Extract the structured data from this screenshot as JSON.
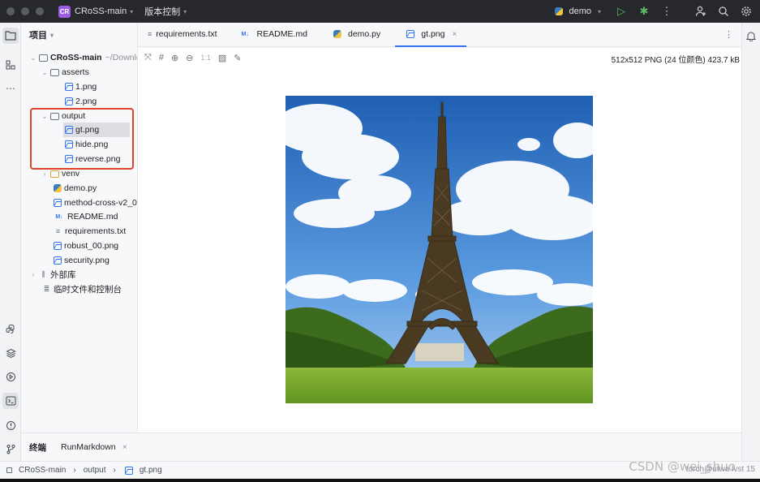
{
  "titlebar": {
    "project_badge": "CR",
    "project_name": "CRoSS-main",
    "vcs_label": "版本控制",
    "run_config": "demo",
    "icons": [
      "run-icon",
      "debug-icon",
      "more-icon",
      "add-user-icon",
      "search-icon",
      "settings-icon"
    ]
  },
  "project_panel": {
    "title": "项目",
    "root_name": "CRoSS-main",
    "root_path": "~/Downlo",
    "items": [
      {
        "label": "asserts",
        "type": "folder"
      },
      {
        "label": "1.png",
        "type": "image"
      },
      {
        "label": "2.png",
        "type": "image"
      },
      {
        "label": "output",
        "type": "folder"
      },
      {
        "label": "gt.png",
        "type": "image"
      },
      {
        "label": "hide.png",
        "type": "image"
      },
      {
        "label": "reverse.png",
        "type": "image"
      },
      {
        "label": "venv",
        "type": "folder"
      },
      {
        "label": "demo.py",
        "type": "python"
      },
      {
        "label": "method-cross-v2_0",
        "type": "image"
      },
      {
        "label": "README.md",
        "type": "markdown"
      },
      {
        "label": "requirements.txt",
        "type": "text"
      },
      {
        "label": "robust_00.png",
        "type": "image"
      },
      {
        "label": "security.png",
        "type": "image"
      },
      {
        "label": "外部库",
        "type": "library"
      },
      {
        "label": "临时文件和控制台",
        "type": "scratch"
      }
    ]
  },
  "tabs": [
    {
      "label": "requirements.txt",
      "icon": "text-file-icon"
    },
    {
      "label": "README.md",
      "icon": "markdown-icon",
      "prefix": "M↓"
    },
    {
      "label": "demo.py",
      "icon": "python-icon"
    },
    {
      "label": "gt.png",
      "icon": "image-icon",
      "active": true
    }
  ],
  "image_toolbar": {
    "zoom_label": "1:1",
    "info": "512x512 PNG (24 位颜色) 423.7 kB"
  },
  "bottom": {
    "title": "终端",
    "tab_label": "RunMarkdown"
  },
  "statusbar": {
    "crumbs": [
      "CRoSS-main",
      "output",
      "gt.png"
    ],
    "right": "torch@utwa lvst 15"
  },
  "watermark": "CSDN @wei_shuo",
  "colors": {
    "accent": "#3574f0",
    "highlight_box": "#e0442e",
    "titlebar": "#27282c"
  }
}
